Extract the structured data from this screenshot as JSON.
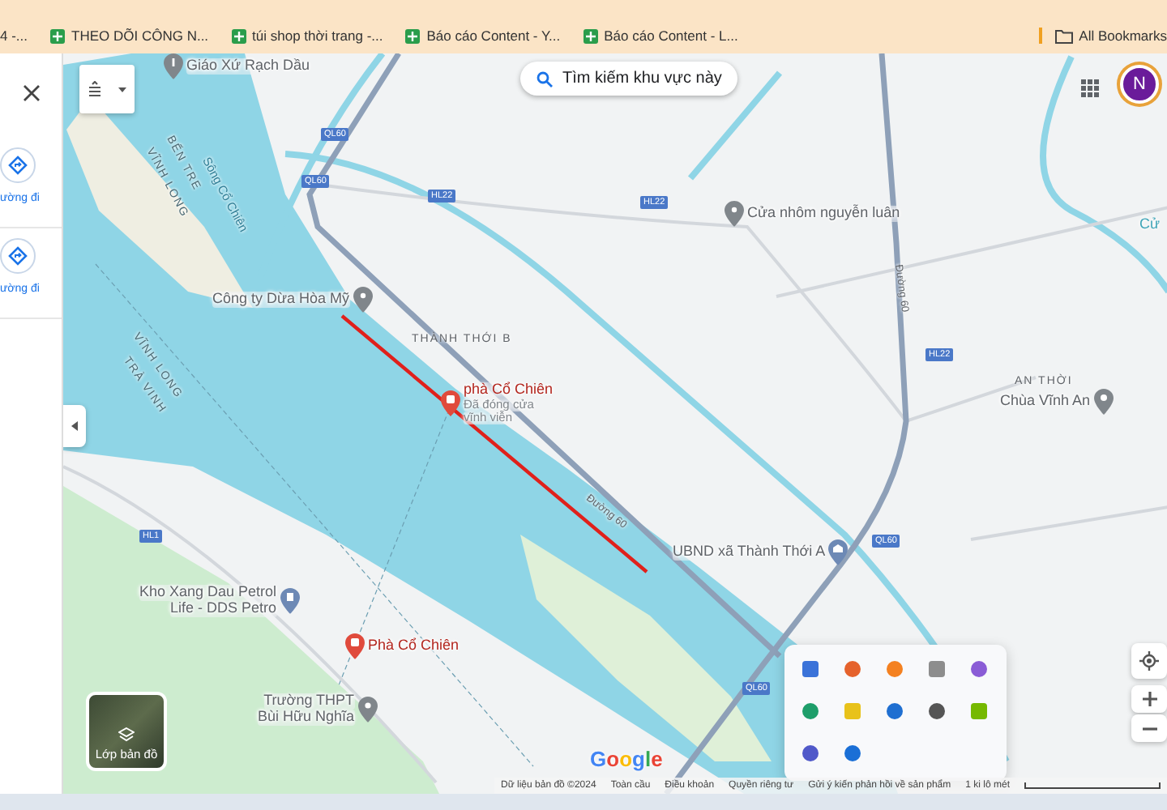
{
  "bookmarks_bar": {
    "items": [
      {
        "label": "4 -...",
        "kind": "partial"
      },
      {
        "label": "THEO DÕI CÔNG N...",
        "kind": "sheet"
      },
      {
        "label": "túi shop thời trang -...",
        "kind": "sheet"
      },
      {
        "label": "Báo cáo Content - Y...",
        "kind": "sheet"
      },
      {
        "label": "Báo cáo Content - L...",
        "kind": "sheet"
      }
    ],
    "all_bookmarks": "All Bookmarks"
  },
  "side_panel": {
    "actions": [
      {
        "label": "ường đi"
      },
      {
        "label": "ường đi"
      }
    ]
  },
  "map": {
    "search_area_button": "Tìm kiếm khu vực này",
    "account_initial": "N",
    "region_labels": [
      "BẾN TRE",
      "VĨNH LONG",
      "Sông Cổ Chiên",
      "VĨNH LONG",
      "TRÀ VINH"
    ],
    "road_names": [
      "Đường 60",
      "Đường 60"
    ],
    "area_labels": [
      "THÀNH THỚI B",
      "AN THỜI",
      "Cử"
    ],
    "road_badges": [
      "HL22",
      "QL60",
      "QL60",
      "HL22",
      "HL22",
      "QL60",
      "QL60",
      "HL1"
    ],
    "places": [
      {
        "lines": [
          "Giáo Xứ Rạch Dầu"
        ],
        "kind": "church"
      },
      {
        "lines": [
          "Công ty Dừa Hòa Mỹ"
        ],
        "kind": "place"
      },
      {
        "lines": [
          "phà Cổ Chiên",
          "Đã đóng cửa",
          "vĩnh viễn"
        ],
        "kind": "ferry"
      },
      {
        "lines": [
          "Cửa nhôm nguyễn luân"
        ],
        "kind": "place"
      },
      {
        "lines": [
          "Chùa Vĩnh An"
        ],
        "kind": "temple"
      },
      {
        "lines": [
          "UBND xã Thành Thới A"
        ],
        "kind": "office"
      },
      {
        "lines": [
          "Kho Xang Dau Petrol",
          "Life - DDS Petro"
        ],
        "kind": "gas"
      },
      {
        "lines": [
          "Phà Cổ Chiên"
        ],
        "kind": "ferry"
      },
      {
        "lines": [
          "Trường THPT",
          "Bùi Hữu Nghĩa"
        ],
        "kind": "school"
      }
    ],
    "layers_button": "Lớp bản đồ",
    "logo": "Google",
    "footer_links": [
      "Dữ liệu bản đồ ©2024",
      "Toàn cầu",
      "Điều khoản",
      "Quyền riêng tư",
      "Gửi ý kiến phản hồi về sản phẩm"
    ],
    "scale_label": "1 ki lô mét"
  }
}
